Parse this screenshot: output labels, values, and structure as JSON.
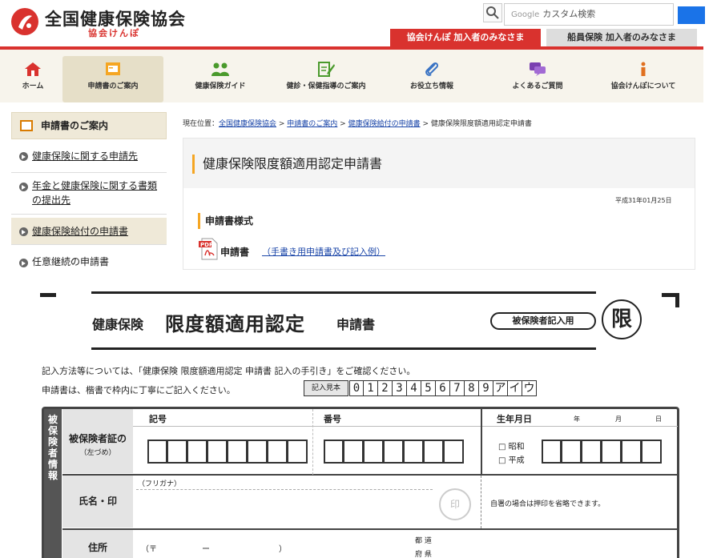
{
  "header": {
    "site_title": "全国健康保険協会",
    "site_subtitle": "協会けんぽ",
    "search_prefix": "Google",
    "search_placeholder": "カスタム検索",
    "tab_members": "協会けんぽ 加入者のみなさま",
    "tab_seamen": "船員保険 加入者のみなさま",
    "brand_color": "#d9322e"
  },
  "nav": {
    "items": [
      {
        "label": "ホーム",
        "icon": "home-icon"
      },
      {
        "label": "申請書のご案内",
        "icon": "form-icon"
      },
      {
        "label": "健康保険ガイド",
        "icon": "people-icon"
      },
      {
        "label": "健診・保健指導のご案内",
        "icon": "clipboard-pen-icon"
      },
      {
        "label": "お役立ち情報",
        "icon": "paperclip-icon"
      },
      {
        "label": "よくあるご質問",
        "icon": "chat-icon"
      },
      {
        "label": "協会けんぽについて",
        "icon": "info-icon"
      }
    ]
  },
  "sidebar": {
    "heading": "申請書のご案内",
    "items": [
      {
        "label": "健康保険に関する申請先"
      },
      {
        "label": "年金と健康保険に関する書類の提出先"
      },
      {
        "label": "健康保険給付の申請書"
      },
      {
        "label": "任意継続の申請書"
      }
    ]
  },
  "breadcrumb": {
    "prefix": "現在位置：",
    "links": [
      "全国健康保険協会",
      "申請書のご案内",
      "健康保険給付の申請書"
    ],
    "sep": " > ",
    "current": "健康保険限度額適用認定申請書"
  },
  "main": {
    "title": "健康保険限度額適用認定申請書",
    "date": "平成31年01月25日",
    "section_heading": "申請書様式",
    "pdf_label": "申請書",
    "pdf_link": "（手書き用申請書及び記入例）"
  },
  "form": {
    "title_prefix": "健康保険",
    "title_main": "限度額適用認定",
    "title_suffix": "申請書",
    "pill": "被保険者記入用",
    "stamp": "限",
    "instruction1": "記入方法等については、「健康保険 限度額適用認定 申請書 記入の手引き」をご確認ください。",
    "instruction2": "申請書は、楷書で枠内に丁寧にご記入ください。",
    "sample_label": "記入見本",
    "sample_chars": [
      "0",
      "1",
      "2",
      "3",
      "4",
      "5",
      "6",
      "7",
      "8",
      "9",
      "ア",
      "イ",
      "ウ"
    ],
    "side_label": "被保険者情報",
    "col_kigou": "記号",
    "col_bangou": "番号",
    "col_birth": "生年月日",
    "birth_year": "年",
    "birth_month": "月",
    "birth_day": "日",
    "row_card_line1": "被保険者証の",
    "row_card_line2": "（左づめ）",
    "era_showa": "□ 昭和",
    "era_heisei": "□ 平成",
    "furigana": "（フリガナ）",
    "row_name": "氏名・印",
    "seal": "印",
    "seal_note": "自署の場合は押印を省略できます。",
    "row_address": "住所",
    "postal_open": "（〒",
    "postal_dash": "ー",
    "postal_close": "）",
    "pref1": "都 道",
    "pref2": "府 県"
  }
}
